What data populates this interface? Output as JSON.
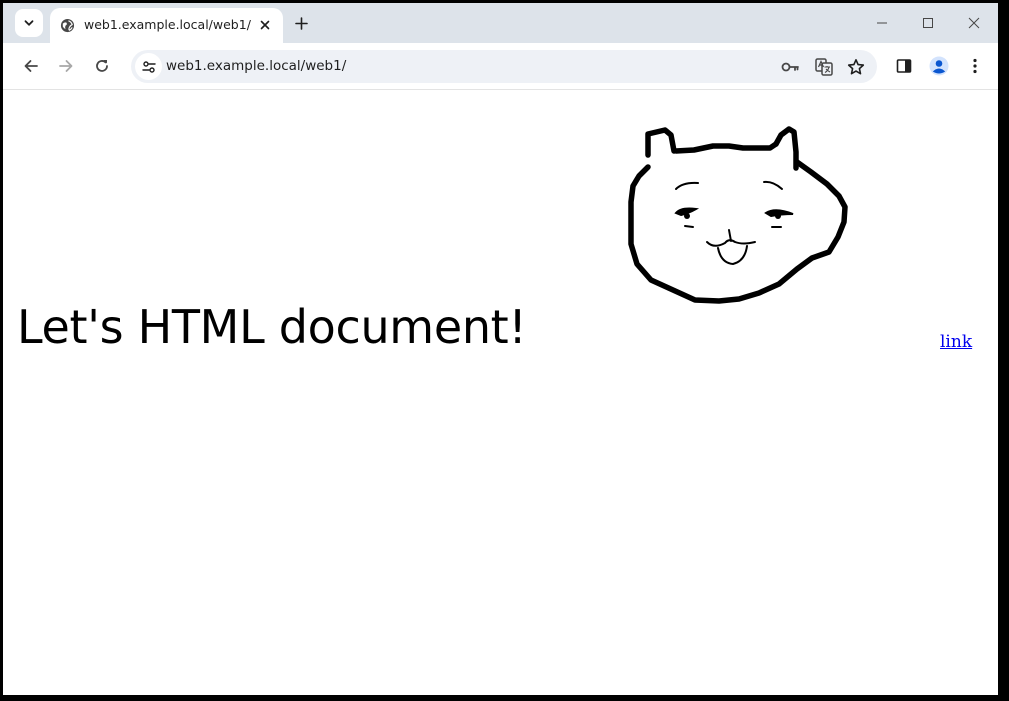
{
  "browser": {
    "tab": {
      "title": "web1.example.local/web1/",
      "favicon": "globe-icon"
    },
    "address_bar": {
      "url": "web1.example.local/web1/"
    },
    "icons": {
      "tab_search": "chevron-down-icon",
      "close_tab": "close-icon",
      "new_tab": "plus-icon",
      "minimize": "minimize-icon",
      "maximize": "maximize-icon",
      "close_window": "close-icon",
      "back": "arrow-left-icon",
      "forward": "arrow-right-icon",
      "reload": "reload-icon",
      "site_info": "tune-icon",
      "password": "key-icon",
      "translate": "translate-icon",
      "bookmark": "star-icon",
      "side_panel": "side-panel-icon",
      "profile": "profile-icon",
      "menu": "kebab-menu-icon"
    },
    "colors": {
      "tabstrip": "#dde3ea",
      "omnibox": "#eef1f6",
      "profile": "#0b57d0"
    }
  },
  "page": {
    "heading": "Let's HTML document!",
    "link_text": "link",
    "image": "cat-face-drawing"
  }
}
